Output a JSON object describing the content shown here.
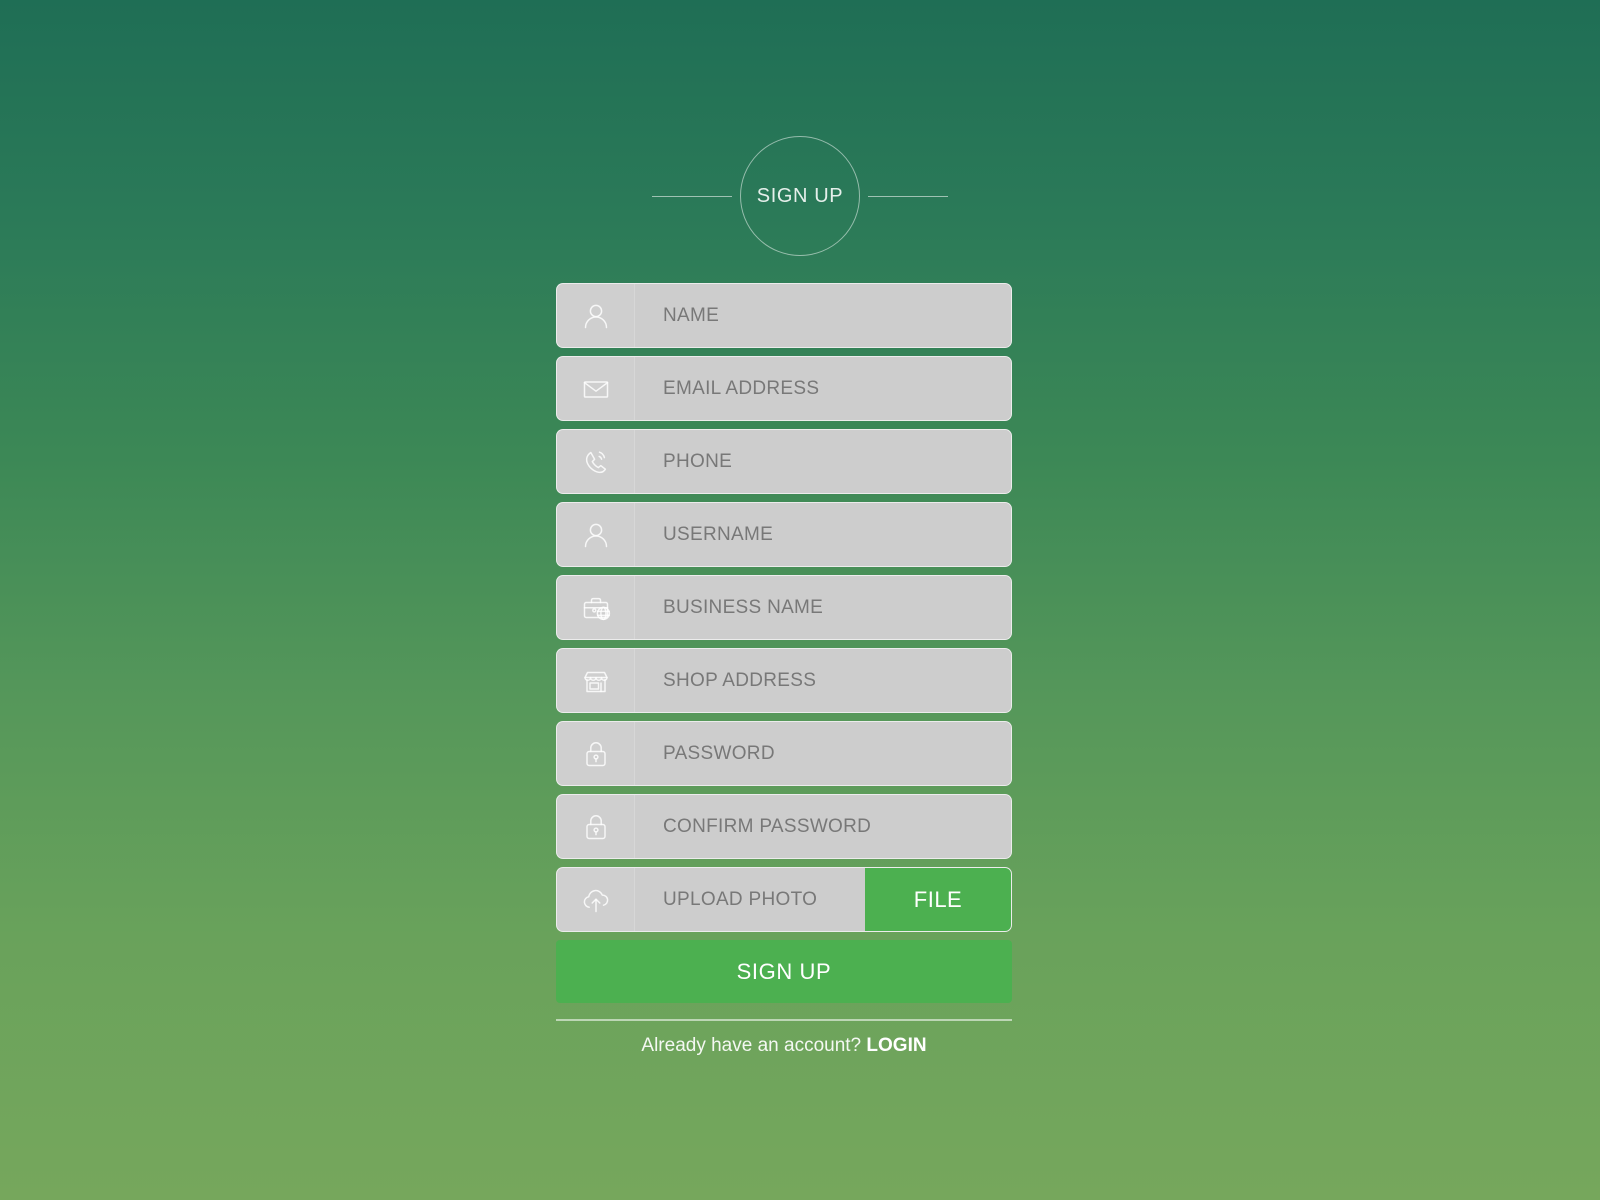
{
  "header": {
    "title": "SIGN UP"
  },
  "form": {
    "fields": [
      {
        "name": "name",
        "placeholder": "NAME",
        "icon": "user-icon"
      },
      {
        "name": "email",
        "placeholder": "EMAIL ADDRESS",
        "icon": "envelope-icon"
      },
      {
        "name": "phone",
        "placeholder": "PHONE",
        "icon": "phone-ring-icon"
      },
      {
        "name": "username",
        "placeholder": "USERNAME",
        "icon": "user-icon"
      },
      {
        "name": "business-name",
        "placeholder": "BUSINESS NAME",
        "icon": "briefcase-globe-icon"
      },
      {
        "name": "shop-address",
        "placeholder": "SHOP ADDRESS",
        "icon": "storefront-icon"
      },
      {
        "name": "password",
        "placeholder": "PASSWORD",
        "icon": "padlock-icon"
      },
      {
        "name": "confirm-password",
        "placeholder": "CONFIRM PASSWORD",
        "icon": "padlock-icon"
      }
    ],
    "upload": {
      "placeholder": "UPLOAD PHOTO",
      "icon": "cloud-upload-icon",
      "button_label": "FILE"
    },
    "submit_label": "SIGN UP"
  },
  "footer": {
    "prompt": "Already have an account?",
    "login_label": "LOGIN"
  },
  "colors": {
    "background_top": "#1f6e55",
    "background_bottom": "#76a75c",
    "accent_green": "#4cb050",
    "input_background": "#cdcdcd",
    "placeholder_text": "#787878"
  }
}
